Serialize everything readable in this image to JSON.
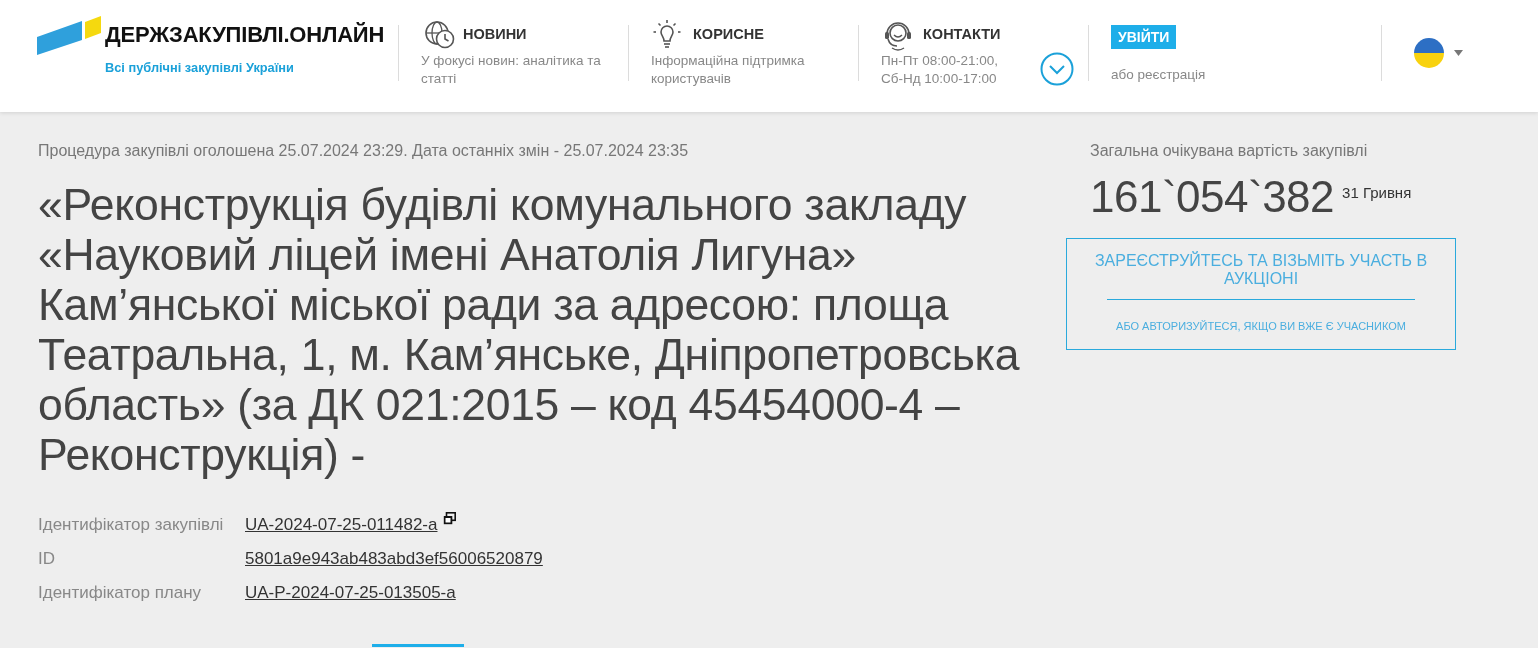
{
  "header": {
    "logo": {
      "title": "ДЕРЖЗАКУПІВЛІ.ОНЛАЙН",
      "tagline": "Всі публічні закупівлі України"
    },
    "nav": [
      {
        "kind": "news",
        "title": "НОВИНИ",
        "description": [
          "У фокусі новин: аналітика та",
          "статті"
        ]
      },
      {
        "kind": "useful",
        "title": "КОРИСНЕ",
        "description": [
          "Інформаційна підтримка",
          "користувачів"
        ]
      },
      {
        "kind": "contacts",
        "title": "КОНТАКТИ",
        "description": [
          "Пн-Пт 08:00-21:00,",
          "Сб-Нд 10:00-17:00"
        ]
      }
    ],
    "login": {
      "button": "УВІЙТИ",
      "register_link": "або реєстрація"
    }
  },
  "procedure": {
    "announced": "Процедура закупівлі оголошена 25.07.2024 23:29. Дата останніх змін - 25.07.2024 23:35",
    "title": "«Реконструкція будівлі комунального закладу «Науковий ліцей імені Анатолія Лигуна» Кам’янської міської ради за адресою: площа Театральна, 1, м. Кам’янське, Дніпропетровська область» (за ДК 021:2015 – код 45454000-4 – Реконструкція) -",
    "identifiers": [
      {
        "label": "Ідентифікатор закупівлі",
        "value": "UA-2024-07-25-011482-a",
        "copyable": true
      },
      {
        "label": "ID",
        "value": "5801a9e943ab483abd3ef56006520879",
        "copyable": false
      },
      {
        "label": "Ідентифікатор плану",
        "value": "UA-P-2024-07-25-013505-a",
        "copyable": false
      }
    ]
  },
  "budget": {
    "label": "Загальна очікувана вартість закупівлі",
    "amount": "161`054`382",
    "amount_suffix": "31 Гривня"
  },
  "participation": {
    "register": "ЗАРЕЄСТРУЙТЕСЬ ТА ВІЗЬМІТЬ УЧАСТЬ В АУКЦІОНІ",
    "login": "АБО АВТОРИЗУЙТЕСЯ, ЯКЩО ВИ ВЖЕ Є УЧАСНИКОМ"
  }
}
